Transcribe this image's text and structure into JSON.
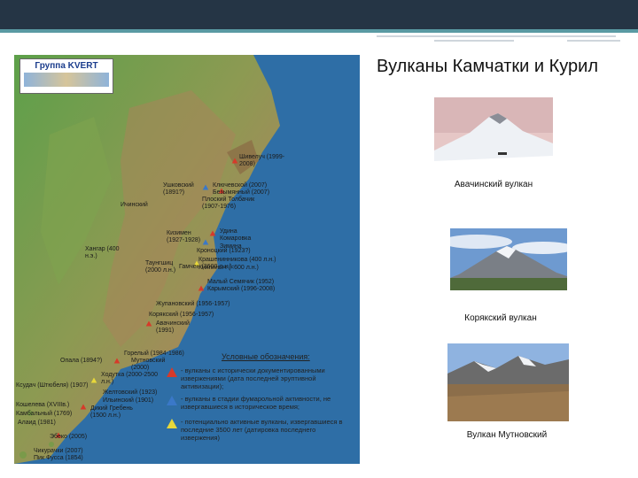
{
  "slide": {
    "title": "Вулканы Камчатки и Курил"
  },
  "map": {
    "logo_text": "Группа KVERT",
    "labels": [
      "Шивелуч (1999-2008)",
      "Ушковский (1891?)",
      "Ключевской (2007)",
      "Безымянный (2007)",
      "Плоский Толбачик (1907-1976)",
      "Ичинский",
      "Кизимен (1927-1928)",
      "Удина",
      "Зимина",
      "Хангар (400 н.э.)",
      "Кроноцкий (1923?)",
      "Комаровка",
      "Гамчен (3600 л.н.)",
      "Таунгшиц (2000 л.н.)",
      "Крашенинникова (400 л.н.)",
      "Кихпиныч (<600 л.н.)",
      "Малый Семячик (1952)",
      "Карымский (1996-2008)",
      "Жупановский (1956-1957)",
      "Корякский (1956-1957)",
      "Авачинский (1991)",
      "Горелый (1984-1986)",
      "Мутновский (2000)",
      "Опала (1894?)",
      "Ходутка (2000-2500 л.н.)",
      "Ксудач (Штюбеля) (1907)",
      "Желтовский (1923)",
      "Ильинский (1901)",
      "Кошелева (XVIIIв.)",
      "Дикий Гребень (1500 л.н.)",
      "Камбальный (1769)",
      "Алаид (1981)",
      "Эбеко (2005)",
      "Чикурачки (2007)",
      "Пик Фусса (1854)"
    ],
    "legend": {
      "title": "Условные обозначения:",
      "items": [
        {
          "color": "#d63a2a",
          "text": "- вулканы с исторически документированными извержениями (дата последней эруптивной активизации);"
        },
        {
          "color": "#3a78c8",
          "text": "- вулканы в стадии фумарольной активности, не извергавшиеся в историческое время;"
        },
        {
          "color": "#e8d83a",
          "text": "- потенциально активные вулканы, извергавшиеся в последние 3500 лет (датировка последнего извержения)"
        }
      ]
    }
  },
  "photos": [
    {
      "caption": "Авачинский вулкан"
    },
    {
      "caption": "Корякский вулкан"
    },
    {
      "caption": "Вулкан Мутновский"
    }
  ],
  "colors": {
    "header_bar": "#253545",
    "accent": "#5a9aa3",
    "sea": "#2e6ea6"
  }
}
